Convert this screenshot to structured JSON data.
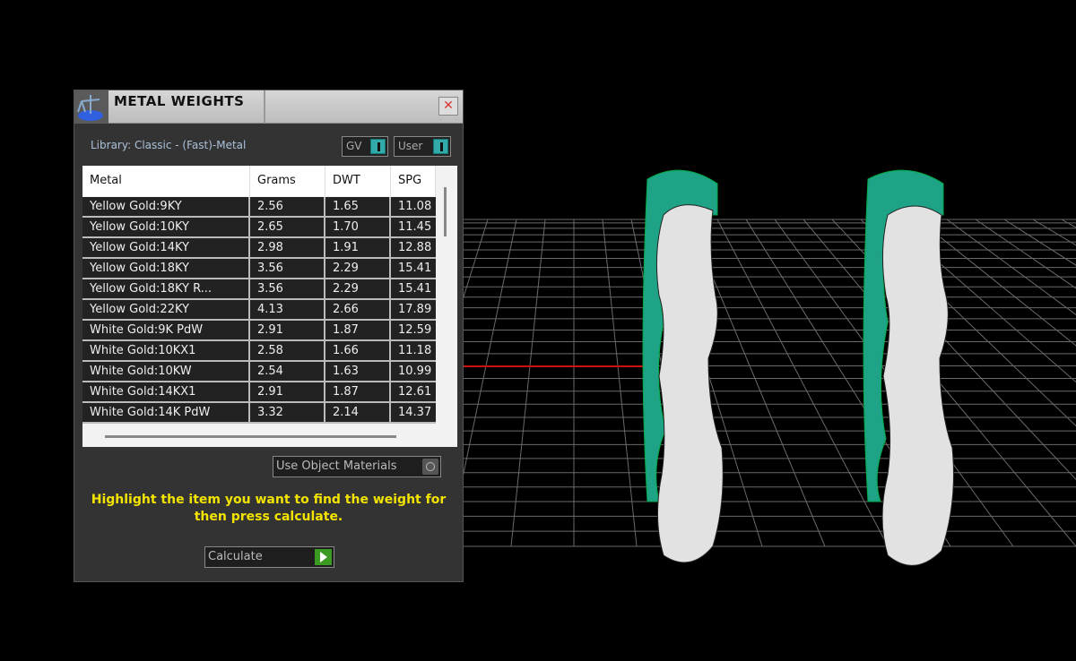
{
  "panel": {
    "title": "METAL WEIGHTS",
    "close": "✕",
    "library": "Library: Classic - (Fast)-Metal",
    "gv_label": "GV",
    "user_label": "User"
  },
  "table": {
    "headers": [
      "Metal",
      "Grams",
      "DWT",
      "SPG"
    ],
    "rows": [
      [
        "Yellow Gold:9KY",
        "2.56",
        "1.65",
        "11.08"
      ],
      [
        "Yellow Gold:10KY",
        "2.65",
        "1.70",
        "11.45"
      ],
      [
        "Yellow Gold:14KY",
        "2.98",
        "1.91",
        "12.88"
      ],
      [
        "Yellow Gold:18KY",
        "3.56",
        "2.29",
        "15.41"
      ],
      [
        "Yellow Gold:18KY R...",
        "3.56",
        "2.29",
        "15.41"
      ],
      [
        "Yellow Gold:22KY",
        "4.13",
        "2.66",
        "17.89"
      ],
      [
        "White Gold:9K PdW",
        "2.91",
        "1.87",
        "12.59"
      ],
      [
        "White Gold:10KX1",
        "2.58",
        "1.66",
        "11.18"
      ],
      [
        "White Gold:10KW",
        "2.54",
        "1.63",
        "10.99"
      ],
      [
        "White Gold:14KX1",
        "2.91",
        "1.87",
        "12.61"
      ],
      [
        "White Gold:14K PdW",
        "3.32",
        "2.14",
        "14.37"
      ]
    ]
  },
  "use_object_materials": "Use Object Materials",
  "message": "Highlight the item you want to find the weight for then press calculate.",
  "calculate": "Calculate",
  "colors": {
    "accent": "#33aaaa",
    "message": "#f2e400",
    "go": "#3a9a22",
    "axis": "#cc1111",
    "ring_metal": "#1fa386"
  }
}
